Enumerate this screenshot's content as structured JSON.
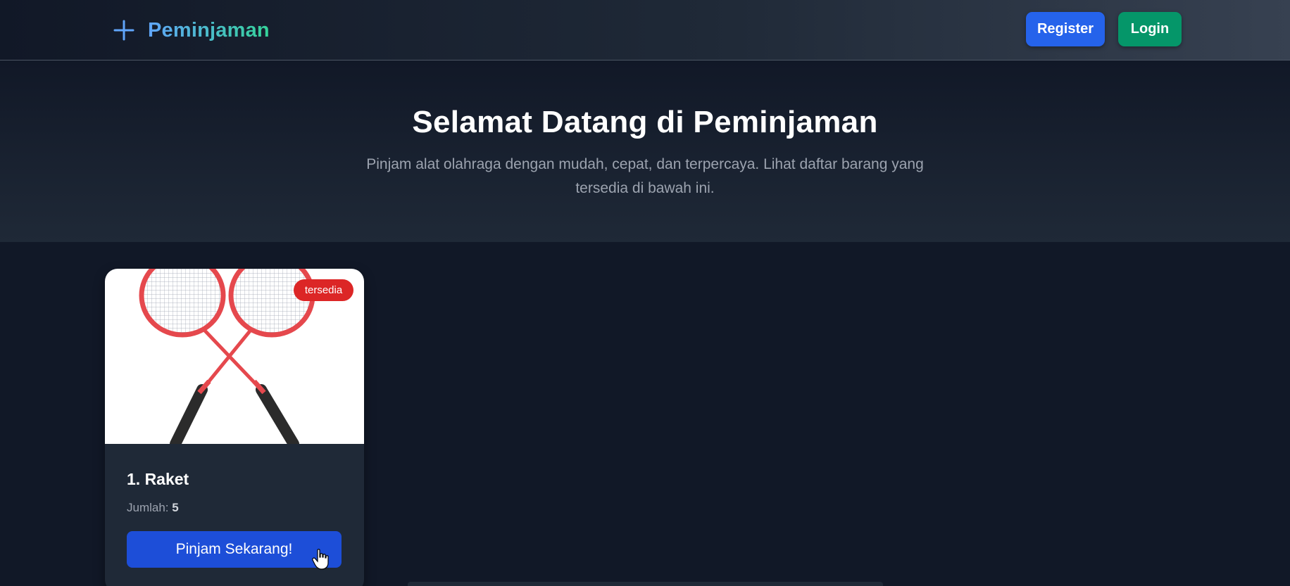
{
  "navbar": {
    "brand": "Peminjaman",
    "brand_icon": "plus-icon",
    "register_label": "Register",
    "login_label": "Login",
    "colors": {
      "register": "#2563eb",
      "login": "#059669"
    }
  },
  "hero": {
    "title": "Selamat Datang di Peminjaman",
    "subtitle": "Pinjam alat olahraga dengan mudah, cepat, dan terpercaya. Lihat daftar barang yang tersedia di bawah ini."
  },
  "items": [
    {
      "title": "1. Raket",
      "badge": "tersedia",
      "quantity_label": "Jumlah:",
      "quantity_value": "5",
      "button_label": "Pinjam Sekarang!",
      "image": "badminton-rackets-image",
      "colors": {
        "badge": "#dc2626",
        "button": "#1d4ed8"
      }
    }
  ]
}
